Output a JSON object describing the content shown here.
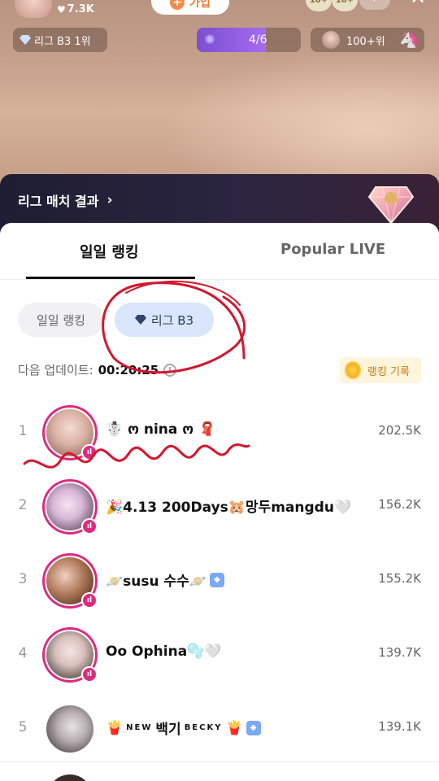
{
  "top_bar": {
    "likes": "7.3K",
    "join_label": "가입",
    "viewer_badges": [
      "10+",
      "10+"
    ]
  },
  "stats": {
    "league_label": "리그 B3 1위",
    "progress_text": "4/6",
    "progress_fraction": 0.6667,
    "rank_label": "100+위"
  },
  "league_banner": {
    "title": "리그 매치 결과",
    "chevron": "›"
  },
  "tabs": [
    {
      "label": "일일 랭킹",
      "active": true
    },
    {
      "label": "Popular LIVE",
      "active": false
    }
  ],
  "filters": [
    {
      "label": "일일 랭킹",
      "selected": false
    },
    {
      "label": "리그 B3",
      "selected": true
    }
  ],
  "update": {
    "label": "다음 업데이트:",
    "time": "00:20:25"
  },
  "record_button": "랭킹 기록",
  "ranking": [
    {
      "rank": "1",
      "name": "☃️ ო nina ო 🧣",
      "score": "202.5K",
      "live": true
    },
    {
      "rank": "2",
      "name": "🎉4.13 200Days🐹망두mangdu🤍",
      "score": "156.2K",
      "live": true
    },
    {
      "rank": "3",
      "name": "🪐susu 수수🪐",
      "score": "155.2K",
      "live": true,
      "verified": true
    },
    {
      "rank": "4",
      "name": "Oo Ophina🫧🤍",
      "score": "139.7K",
      "live": true
    },
    {
      "rank": "5",
      "name_prefix": "🍟",
      "name_small1": "NEW",
      "name_main": "백기",
      "name_small2": "BECKY",
      "name_suffix": "🍟",
      "score": "139.1K",
      "live": false,
      "verified": true
    }
  ],
  "colors": {
    "live_ring": "#e0297e",
    "league_chip_bg": "#d9e6fb",
    "record_btn_bg": "#fff4dc",
    "progress_fill": "#8a5be0"
  },
  "icons": [
    "heart-icon",
    "plus-icon",
    "close-icon",
    "more-icon",
    "diamond-icon",
    "firework-icon",
    "unicorn-icon",
    "chevron-right-icon",
    "gem-trophy-icon",
    "clock-icon",
    "medal-icon",
    "live-icon",
    "verified-icon"
  ]
}
